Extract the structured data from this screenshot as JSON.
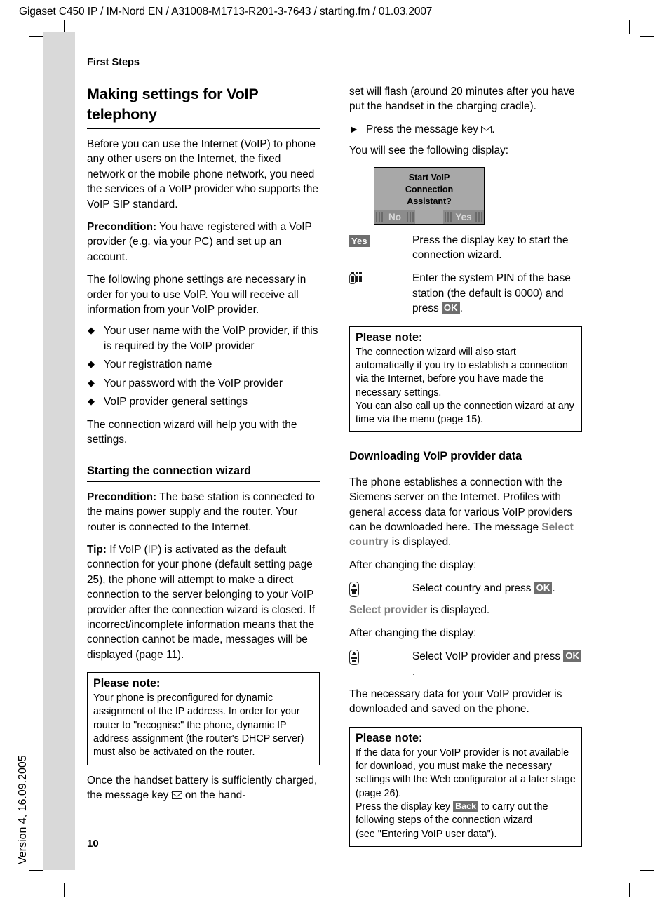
{
  "header": {
    "running_head": "Gigaset C450 IP / IM-Nord EN / A31008-M1713-R201-3-7643 / starting.fm / 01.03.2007"
  },
  "side": {
    "version": "Version 4, 16.09.2005"
  },
  "page": {
    "chapter": "First Steps",
    "number": "10"
  },
  "left": {
    "title": "Making settings for VoIP telephony",
    "intro": "Before you can use the Internet (VoIP) to phone any other users on the Internet, the fixed network or the mobile phone network, you need the services of a VoIP provider who supports the VoIP SIP standard.",
    "precondition_label": "Precondition:",
    "precondition_text": " You have registered with a VoIP provider (e.g. via your PC) and set up an account.",
    "settings_intro": "The following phone settings are necessary in order for you to use VoIP. You will receive all information from your VoIP provider.",
    "bullets": [
      "Your user name with the VoIP provider, if this is required by the VoIP provider",
      "Your registration name",
      "Your password with the VoIP provider",
      "VoIP provider general settings"
    ],
    "wizard_help": "The connection wizard will help you with the settings.",
    "subhead": "Starting the connection wizard",
    "precondition2_label": "Precondition:",
    "precondition2_text": " The base station is connected to the mains power supply and the router. Your router is connected to the Internet.",
    "tip_label": "Tip:",
    "tip_part1": " If VoIP (",
    "tip_ip": "IP",
    "tip_part2": ") is activated as the default connection for your phone (default setting page 25), the phone will attempt to make a direct connection to the server belonging to your VoIP provider after the connection wizard is closed. If incorrect/incomplete information means that the connection cannot be made, messages will be displayed (page 11).",
    "note": {
      "title": "Please note:",
      "body": "Your phone is preconfigured for dynamic assignment of the IP address. In order for your router to \"recognise\" the phone, dynamic IP address assignment (the router's DHCP server) must also be activated on the router."
    },
    "battery_part1": "Once the handset battery is sufficiently charged, the message key ",
    "battery_part2": " on the hand-"
  },
  "right": {
    "flash_text": "set will flash (around 20 minutes after you have put the handset in the charging cradle).",
    "step_press_part1": "Press the message key ",
    "step_press_part2": ".",
    "see_display": "You will see the following display:",
    "handset_display": {
      "line1": "Start VoIP",
      "line2": "Connection",
      "line3": "Assistant?",
      "softkey_left": "No",
      "softkey_right": "Yes"
    },
    "steps": [
      {
        "key_type": "softkey",
        "key_label": "Yes",
        "text": "Press the display key to start the connection wizard."
      },
      {
        "key_type": "keypad",
        "key_label": "keypad-icon",
        "text_part1": "Enter the system PIN of the base station (the default is 0000) and press ",
        "text_key": "OK",
        "text_part2": "."
      }
    ],
    "note1": {
      "title": "Please note:",
      "body1": "The connection wizard will also start automatically if you try to establish a connection via the Internet, before you have made the necessary settings.",
      "body2": "You can also call up the connection wizard at any time via the menu (page 15)."
    },
    "subhead": "Downloading VoIP provider data",
    "download_part1": "The phone establishes a connection with the Siemens server on the Internet. Profiles with general access data for various VoIP providers can be downloaded here. The message ",
    "download_display": "Select country",
    "download_part2": " is displayed.",
    "after_change_1": "After changing the display:",
    "select_country_part1": "Select country and press ",
    "select_country_key": "OK",
    "select_country_part2": ".",
    "select_provider_display": "Select provider",
    "select_provider_rest": " is displayed.",
    "after_change_2": "After changing the display:",
    "select_voip_part1": "Select VoIP provider and press ",
    "select_voip_key": "OK",
    "select_voip_part2": ".",
    "downloaded_text": "The necessary data for your VoIP provider is downloaded and saved on the phone.",
    "note2": {
      "title": "Please note:",
      "body1": "If the data for your VoIP provider is not available for download, you must make the necessary settings with the Web configurator at a later stage (page 26).",
      "body2_part1": "Press the display key ",
      "body2_key": "Back",
      "body2_part2": " to carry out the following steps of the connection wizard",
      "body3": "(see \"Entering VoIP user data\")."
    }
  },
  "colors": {
    "display_text": "#7d7d7d",
    "softkey_bg": "#6e6e6e",
    "tab_gray": "#d9d9d9",
    "handset_bg": "#a8a8a8"
  }
}
